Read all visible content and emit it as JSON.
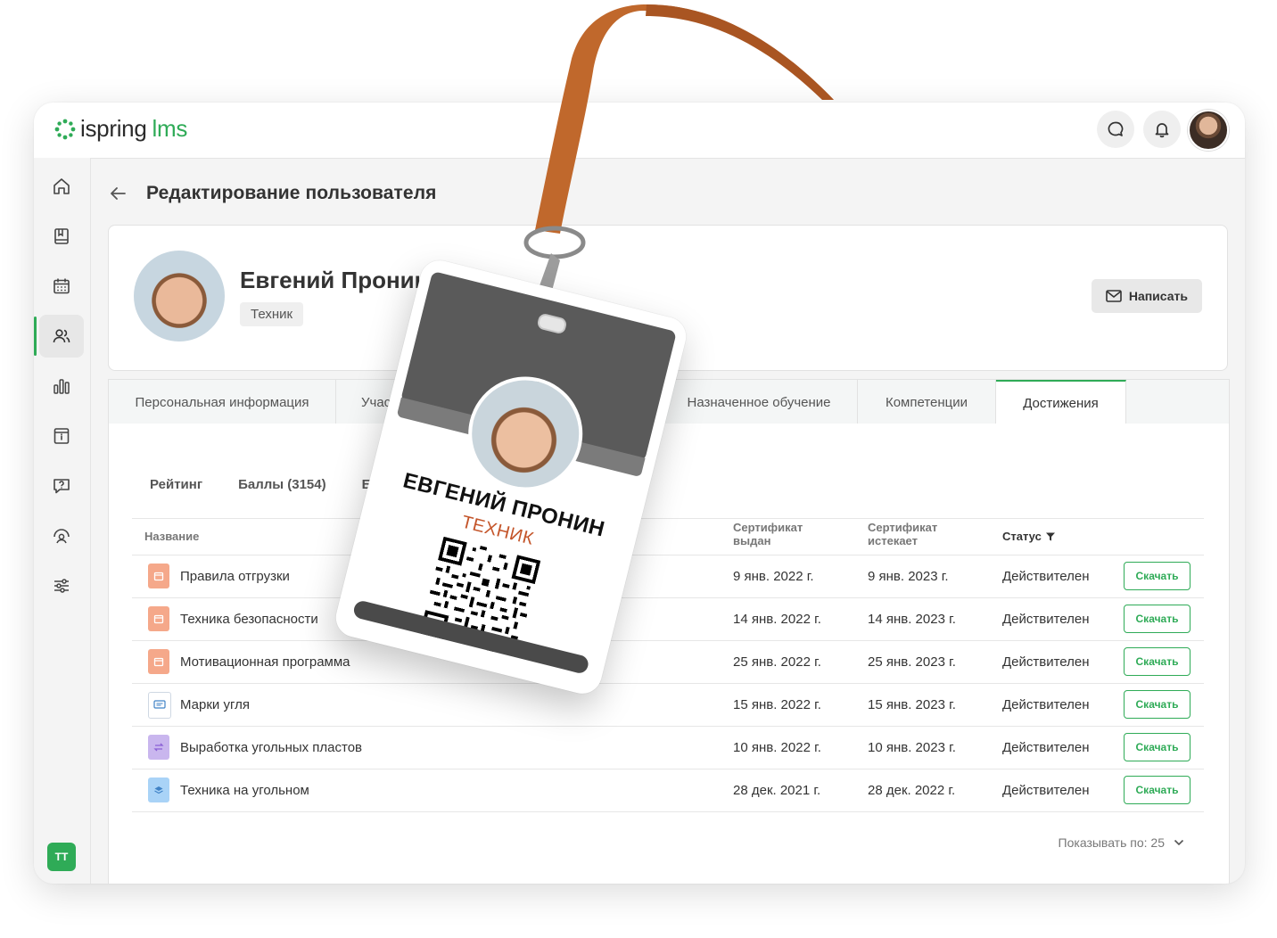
{
  "app": {
    "logo_text": "ispring",
    "logo_suffix": "lms"
  },
  "page": {
    "title": "Редактирование пользователя"
  },
  "profile": {
    "name": "Евгений Пронин",
    "role": "Техник",
    "write_button": "Написать"
  },
  "tabs": [
    {
      "label": "Персональная информация"
    },
    {
      "label": "Участ"
    },
    {
      "label": "Назначенное обучение"
    },
    {
      "label": "Компетенции"
    },
    {
      "label": "Достижения"
    }
  ],
  "subtabs": [
    {
      "label": "Рейтинг"
    },
    {
      "label": "Баллы (3154)"
    },
    {
      "label": "Бе"
    }
  ],
  "table": {
    "headers": {
      "name": "Название",
      "issued_line1": "Сертификат",
      "issued_line2": "выдан",
      "expires_line1": "Сертификат",
      "expires_line2": "истекает",
      "status": "Статус"
    },
    "rows": [
      {
        "name": "Правила отгрузки",
        "issued": "9 янв. 2022 г.",
        "expires": "9 янв. 2023 г.",
        "status": "Действителен",
        "action": "Скачать",
        "icon": "calendar-doc-icon",
        "icon_color": "#f5a88a"
      },
      {
        "name": "Техника безопасности",
        "issued": "14 янв. 2022 г.",
        "expires": "14 янв. 2023 г.",
        "status": "Действителен",
        "action": "Скачать",
        "icon": "calendar-doc-icon",
        "icon_color": "#f5a88a"
      },
      {
        "name": "Мотивационная программа",
        "issued": "25 янв. 2022 г.",
        "expires": "25 янв. 2023 г.",
        "status": "Действителен",
        "action": "Скачать",
        "icon": "calendar-doc-icon",
        "icon_color": "#f5a88a"
      },
      {
        "name": "Марки угля",
        "issued": "15 янв. 2022 г.",
        "expires": "15 янв. 2023 г.",
        "status": "Действителен",
        "action": "Скачать",
        "icon": "chat-doc-icon",
        "icon_color": "#ffffff"
      },
      {
        "name": "Выработка угольных пластов",
        "issued": "10 янв. 2022 г.",
        "expires": "10 янв. 2023 г.",
        "status": "Действителен",
        "action": "Скачать",
        "icon": "swap-doc-icon",
        "icon_color": "#c9b6ee"
      },
      {
        "name": "Техника на угольном",
        "issued": "28 дек. 2021 г.",
        "expires": "28 дек. 2022 г.",
        "status": "Действителен",
        "action": "Скачать",
        "icon": "layers-doc-icon",
        "icon_color": "#a9d3f7"
      }
    ]
  },
  "pager": {
    "label": "Показывать по: 25"
  },
  "user_chip": "ТТ",
  "badge": {
    "name": "ЕВГЕНИЙ ПРОНИН",
    "role": "ТЕХНИК"
  },
  "colors": {
    "accent": "#2fab57",
    "lanyard": "#c0682c",
    "badge_role": "#c4552a"
  }
}
